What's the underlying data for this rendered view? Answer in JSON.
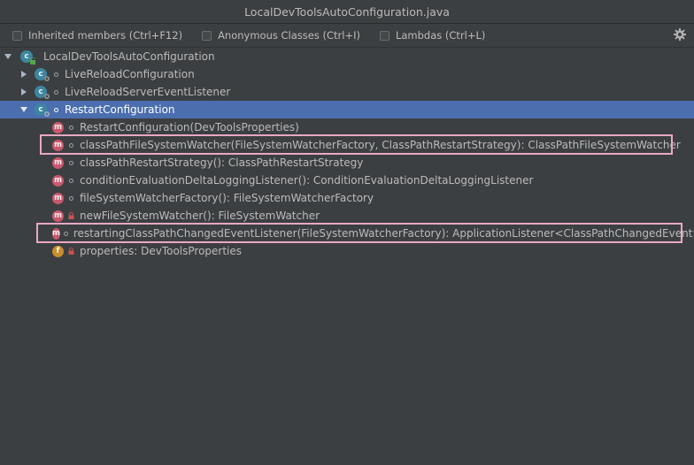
{
  "window": {
    "title": "LocalDevToolsAutoConfiguration.java"
  },
  "toolbar": {
    "inherited_label": "Inherited members (Ctrl+F12)",
    "anonymous_label": "Anonymous Classes (Ctrl+I)",
    "lambdas_label": "Lambdas (Ctrl+L)"
  },
  "tree": {
    "root": "LocalDevToolsAutoConfiguration",
    "live_reload": "LiveReloadConfiguration",
    "live_reload_listener": "LiveReloadServerEventListener",
    "restart": "RestartConfiguration",
    "members": [
      {
        "icon": "m",
        "text": "RestartConfiguration(DevToolsProperties)"
      },
      {
        "icon": "m",
        "text": "classPathFileSystemWatcher(FileSystemWatcherFactory, ClassPathRestartStrategy): ClassPathFileSystemWatcher"
      },
      {
        "icon": "m",
        "text": "classPathRestartStrategy(): ClassPathRestartStrategy"
      },
      {
        "icon": "m",
        "text": "conditionEvaluationDeltaLoggingListener(): ConditionEvaluationDeltaLoggingListener"
      },
      {
        "icon": "m",
        "text": "fileSystemWatcherFactory(): FileSystemWatcherFactory"
      },
      {
        "icon": "m",
        "text": "newFileSystemWatcher(): FileSystemWatcher"
      },
      {
        "icon": "m",
        "text": "restartingClassPathChangedEventListener(FileSystemWatcherFactory): ApplicationListener<ClassPathChangedEvent>"
      },
      {
        "icon": "f",
        "text": "properties: DevToolsProperties"
      }
    ]
  },
  "colors": {
    "background": "#3c3f41",
    "selection": "#4b6eaf",
    "highlight_box": "#e9a8c4",
    "method_icon": "#c85a6e",
    "field_icon": "#c68f2e",
    "class_icon": "#3e86a0"
  },
  "icons": [
    "gear-icon",
    "class-icon",
    "method-icon",
    "field-icon",
    "lock-icon",
    "expand-arrow-icon",
    "collapse-arrow-icon"
  ]
}
